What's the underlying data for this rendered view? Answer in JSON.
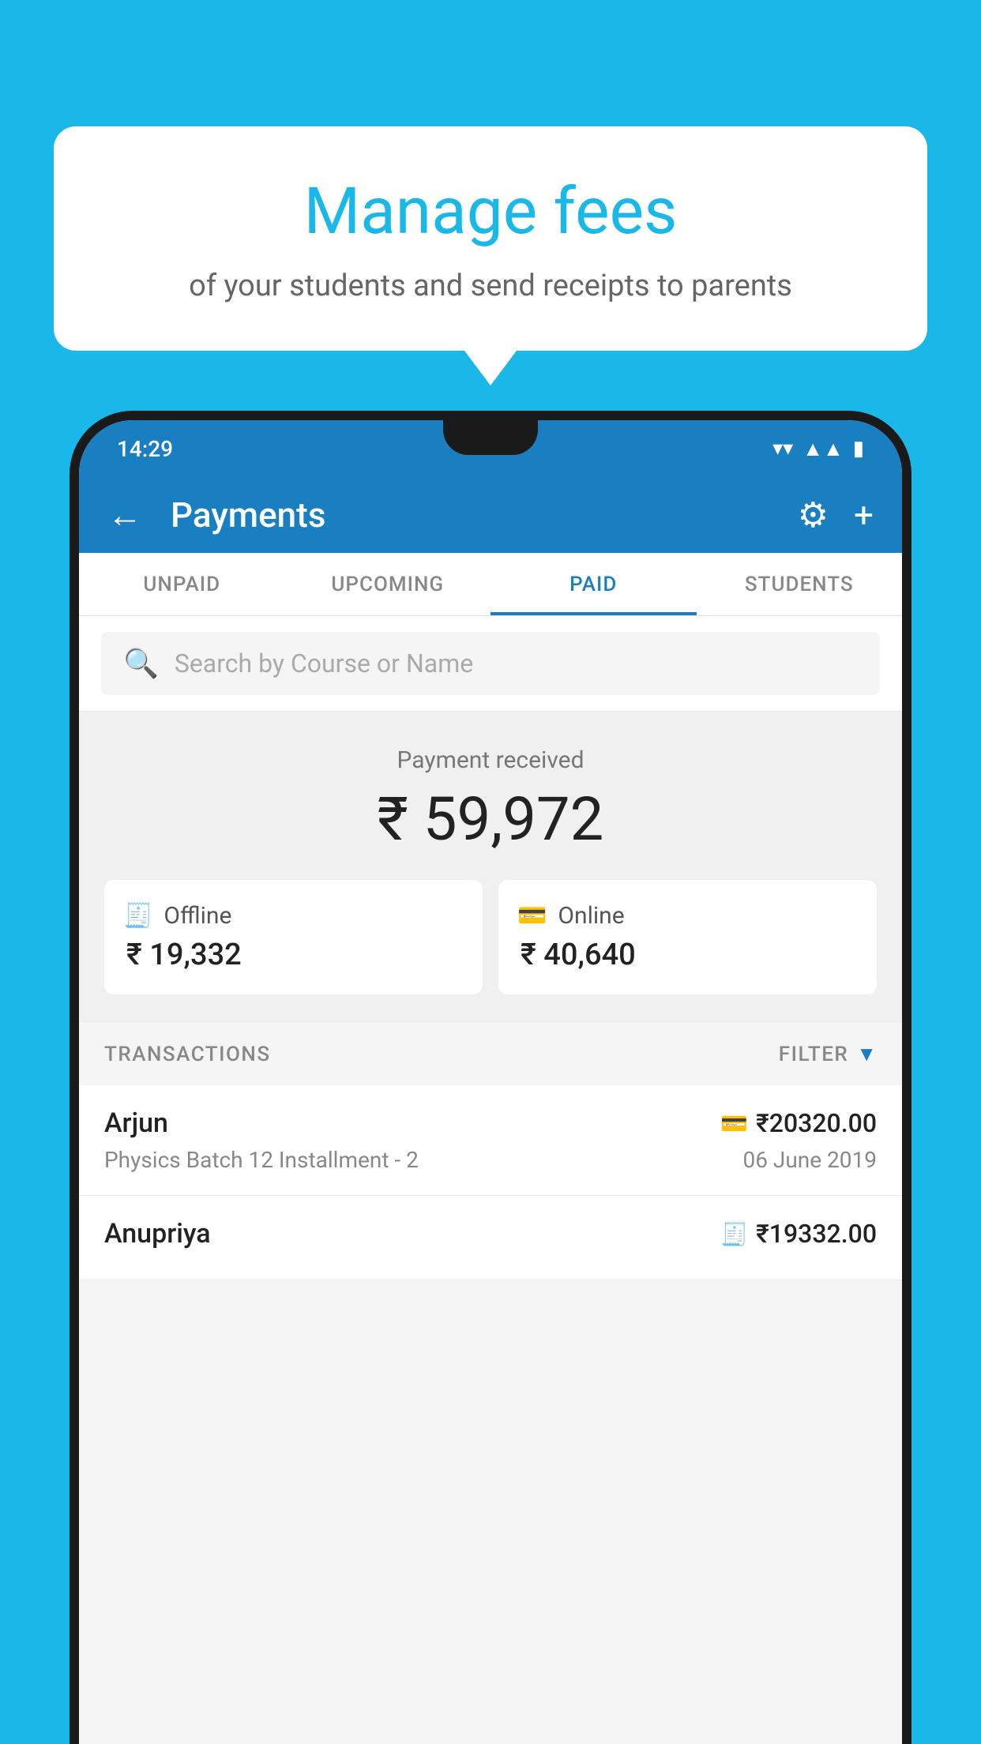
{
  "background_color": "#1ab8e8",
  "speech_bubble": {
    "title": "Manage fees",
    "subtitle": "of your students and send receipts to parents"
  },
  "status_bar": {
    "time": "14:29",
    "wifi_icon": "▾",
    "signal_icon": "▲",
    "battery_icon": "▮"
  },
  "top_bar": {
    "title": "Payments",
    "back_label": "←",
    "settings_icon": "⚙",
    "add_icon": "+"
  },
  "tabs": [
    {
      "label": "UNPAID",
      "active": false
    },
    {
      "label": "UPCOMING",
      "active": false
    },
    {
      "label": "PAID",
      "active": true
    },
    {
      "label": "STUDENTS",
      "active": false
    }
  ],
  "search": {
    "placeholder": "Search by Course or Name"
  },
  "payment_summary": {
    "label": "Payment received",
    "amount": "₹ 59,972",
    "offline": {
      "type": "Offline",
      "amount": "₹ 19,332"
    },
    "online": {
      "type": "Online",
      "amount": "₹ 40,640"
    }
  },
  "transactions": {
    "header_label": "TRANSACTIONS",
    "filter_label": "FILTER",
    "rows": [
      {
        "name": "Arjun",
        "description": "Physics Batch 12 Installment - 2",
        "amount": "₹20320.00",
        "date": "06 June 2019",
        "payment_type": "online"
      },
      {
        "name": "Anupriya",
        "description": "",
        "amount": "₹19332.00",
        "date": "",
        "payment_type": "offline"
      }
    ]
  }
}
